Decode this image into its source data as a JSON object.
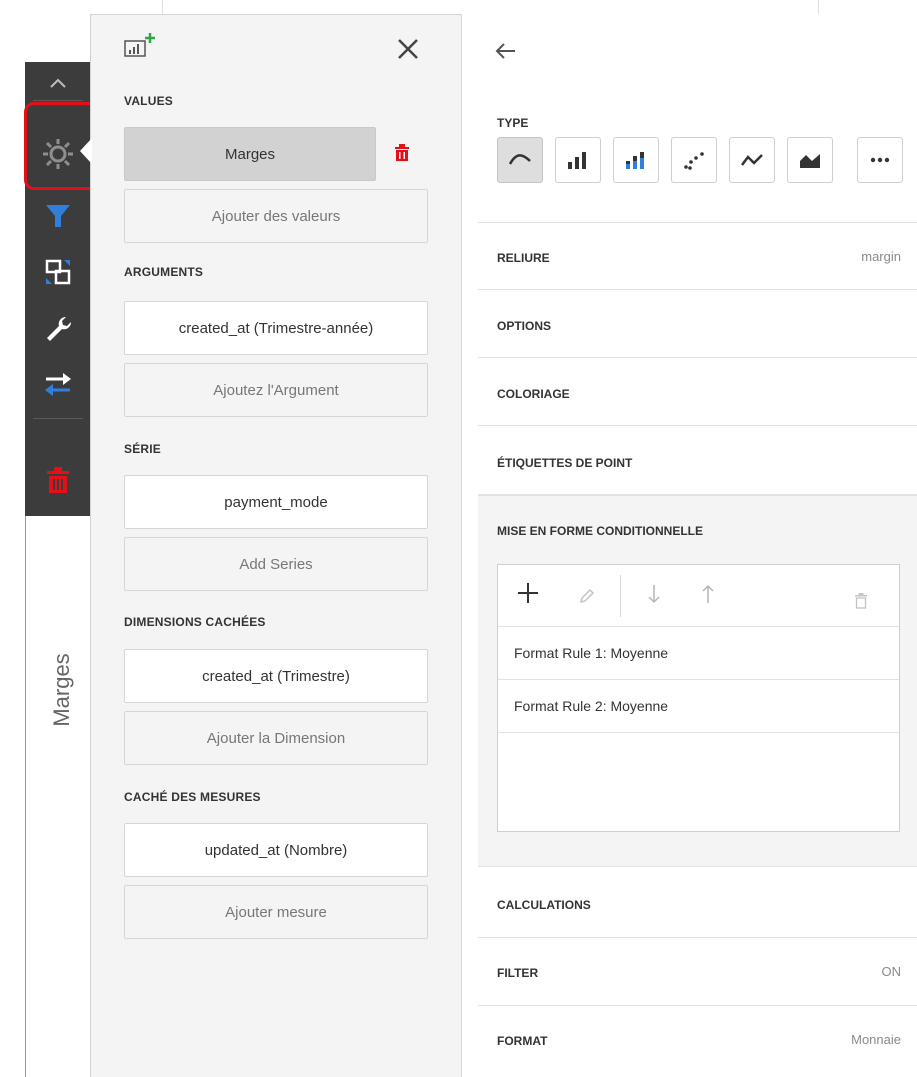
{
  "toolbar": {
    "items": [
      {
        "name": "collapse-icon",
        "active": false
      },
      {
        "name": "gear-icon",
        "active": true
      },
      {
        "name": "filter-icon",
        "color": "#2f7fdb"
      },
      {
        "name": "layout-icon"
      },
      {
        "name": "wrench-icon"
      },
      {
        "name": "swap-icon",
        "color": "#2f7fdb"
      },
      {
        "name": "delete-icon",
        "color": "#e3101a"
      }
    ],
    "vertical_label": "Marges"
  },
  "data_panel": {
    "values_title": "VALUES",
    "values_item": "Marges",
    "values_add": "Ajouter des valeurs",
    "arguments_title": "ARGUMENTS",
    "arguments_item": "created_at (Trimestre-année)",
    "arguments_add": "Ajoutez l'Argument",
    "series_title": "SÉRIE",
    "series_item": "payment_mode",
    "series_add": "Add Series",
    "hidden_dims_title": "DIMENSIONS CACHÉES",
    "hidden_dims_item": "created_at (Trimestre)",
    "hidden_dims_add": "Ajouter la Dimension",
    "hidden_measures_title": "CACHÉ DES MESURES",
    "hidden_measures_item": "updated_at (Nombre)",
    "hidden_measures_add": "Ajouter mesure"
  },
  "settings_panel": {
    "type_title": "TYPE",
    "types": [
      "spline",
      "bar",
      "stacked-bar",
      "scatter",
      "line",
      "area",
      "more"
    ],
    "binding_label": "RELIURE",
    "binding_value": "margin",
    "options_label": "OPTIONS",
    "coloring_label": "COLORIAGE",
    "point_labels_label": "ÉTIQUETTES DE POINT",
    "conditional_formatting_label": "MISE EN FORME CONDITIONNELLE",
    "rules": [
      "Format Rule 1: Moyenne",
      "Format Rule 2: Moyenne"
    ],
    "calculations_label": "CALCULATIONS",
    "filter_label": "FILTER",
    "filter_value": "ON",
    "format_label": "FORMAT",
    "format_value": "Monnaie"
  },
  "colors": {
    "accent_blue": "#2f7fdb",
    "danger_red": "#e3101a",
    "add_green": "#2aa84a"
  }
}
